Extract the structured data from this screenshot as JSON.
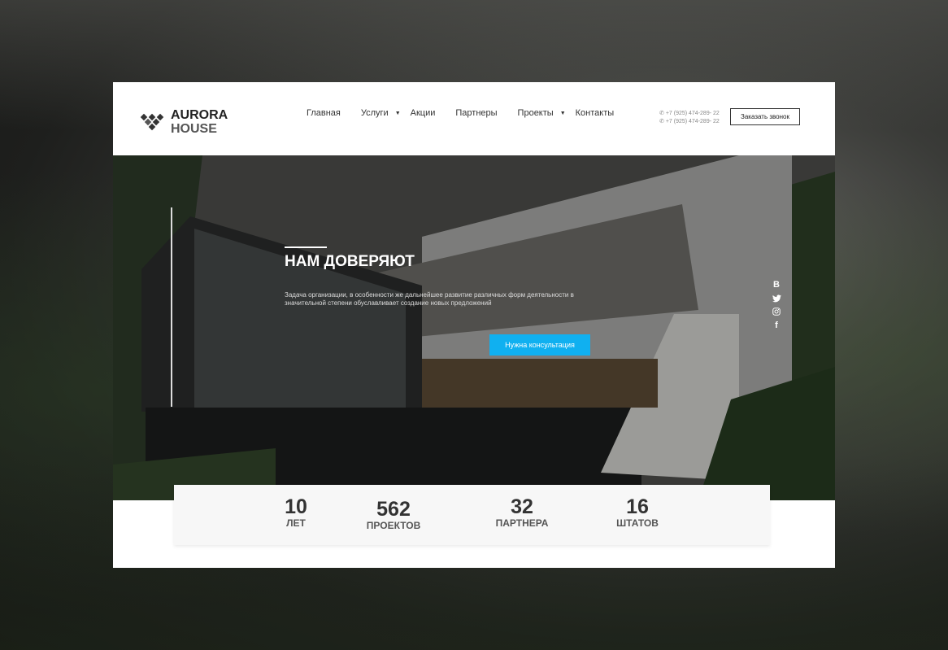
{
  "header": {
    "logo_line1": "AURORA",
    "logo_line2": "HOUSE",
    "nav": [
      "Главная",
      "Услуги",
      "Акции",
      "Партнеры",
      "Проекты",
      "Контакты"
    ],
    "phones": [
      "+7 (925) 474-289- 22",
      "+7 (925) 474-289- 22"
    ],
    "call_button": "Заказать звонок"
  },
  "hero": {
    "title": "НАМ ДОВЕРЯЮТ",
    "description": "Задача организации, в особенности же дальнейшее развитие различных форм деятельности в значительной степени обуславливает создание новых предложений",
    "cta": "Нужна консультация",
    "social": [
      "vk-icon",
      "twitter-icon",
      "instagram-icon",
      "facebook-icon"
    ],
    "vk_glyph": "B",
    "fb_glyph": "f"
  },
  "stats": [
    {
      "value": "10",
      "label": "ЛЕТ"
    },
    {
      "value": "562",
      "label": "ПРОЕКТОВ"
    },
    {
      "value": "32",
      "label": "ПАРТНЕРА"
    },
    {
      "value": "16",
      "label": "ШТАТОВ"
    }
  ],
  "colors": {
    "accent": "#10b0f0"
  }
}
